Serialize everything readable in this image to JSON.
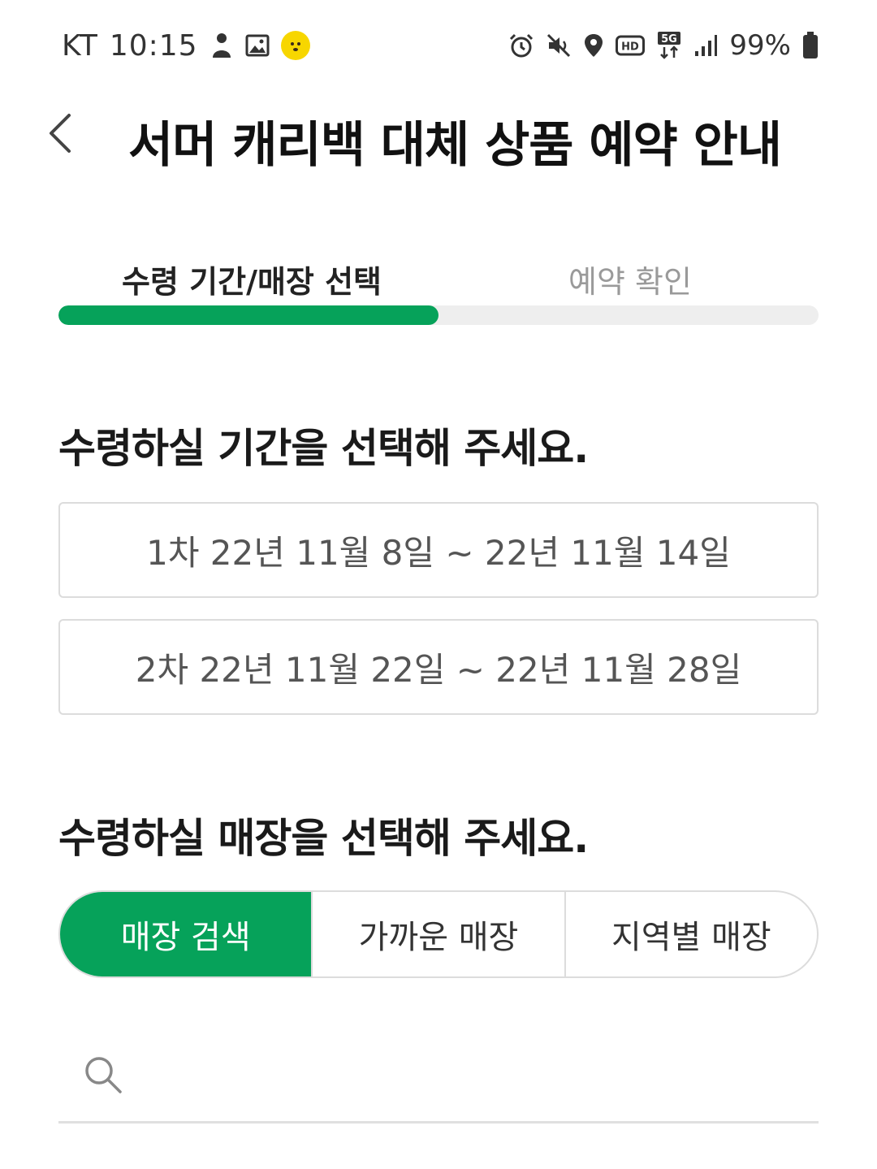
{
  "status_bar": {
    "carrier": "KT",
    "time": "10:15",
    "network": "5G",
    "battery": "99%",
    "icons_left": [
      "person-icon",
      "image-icon",
      "kakao-icon"
    ],
    "icons_right": [
      "alarm-icon",
      "mute-icon",
      "location-icon",
      "hd-icon",
      "5g-icon",
      "signal-icon",
      "battery-icon"
    ]
  },
  "header": {
    "title": "서머 캐리백 대체 상품 예약 안내",
    "back_icon": "chevron-left-icon"
  },
  "steps": {
    "items": [
      {
        "label": "수령 기간/매장 선택",
        "active": true
      },
      {
        "label": "예약 확인",
        "active": false
      }
    ],
    "progress": 0.5,
    "accent_color": "#06a25a"
  },
  "period_section": {
    "heading": "수령하실 기간을 선택해 주세요.",
    "options": [
      {
        "label": "1차 22년 11월 8일 ~ 22년 11월 14일"
      },
      {
        "label": "2차 22년 11월 22일 ~ 22년 11월 28일"
      }
    ]
  },
  "store_section": {
    "heading": "수령하실 매장을 선택해 주세요.",
    "tabs": [
      {
        "label": "매장 검색",
        "active": true
      },
      {
        "label": "가까운 매장",
        "active": false
      },
      {
        "label": "지역별 매장",
        "active": false
      }
    ],
    "search": {
      "placeholder": "",
      "value": ""
    }
  }
}
